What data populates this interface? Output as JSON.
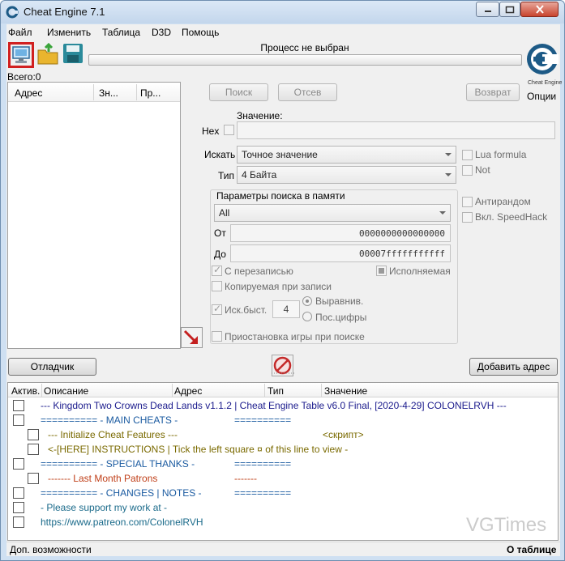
{
  "window": {
    "title": "Cheat Engine 7.1",
    "minimize_icon": "minimize-icon",
    "maximize_icon": "maximize-icon",
    "close_icon": "close-icon"
  },
  "menu": [
    "Файл",
    "Изменить",
    "Таблица",
    "D3D",
    "Помощь"
  ],
  "toolbar": {
    "open_process_icon": "computer-icon",
    "open_file_icon": "folder-icon",
    "save_icon": "floppy-disk-icon"
  },
  "process": {
    "label": "Процесс не выбран"
  },
  "logo": {
    "text": "Cheat Engine",
    "options_label": "Опции"
  },
  "results": {
    "total_label": "Всего:0",
    "columns": [
      "Адрес",
      "Зн...",
      "Пр..."
    ]
  },
  "scan": {
    "first_scan": "Поиск",
    "next_scan": "Отсев",
    "undo_scan": "Возврат",
    "value_label": "Значение:",
    "hex_label": "Hex",
    "scan_type_label": "Искать",
    "scan_type_value": "Точное значение",
    "value_type_label": "Тип",
    "value_type_value": "4 Байта",
    "lua_formula": "Lua formula",
    "not_label": "Not",
    "antirandom": "Антирандом",
    "speedhack": "Вкл. SpeedHack"
  },
  "memory": {
    "group_title": "Параметры поиска в памяти",
    "region_value": "All",
    "from_label": "От",
    "from_value": "0000000000000000",
    "to_label": "До",
    "to_value": "00007fffffffffff",
    "writable": "С перезаписью",
    "executable": "Исполняемая",
    "copy_on_write": "Копируемая при записи",
    "fast_scan": "Иск.быст.",
    "fast_scan_value": "4",
    "alignment": "Выравнив.",
    "last_digits": "Пос.цифры",
    "pause_game": "Приостановка игры при поиске"
  },
  "actions": {
    "debugger": "Отладчик",
    "add_address": "Добавить адрес"
  },
  "cheat_table": {
    "columns": [
      "Актив.",
      "Описание",
      "Адрес",
      "Тип",
      "Значение"
    ],
    "rows": [
      {
        "indent": 0,
        "text": "--- Kingdom Two Crowns Dead Lands v1.1.2 | Cheat Engine Table v6.0 Final, [2020-4-29] COLONELRVH ---",
        "color": "#1a1a8c",
        "extra": ""
      },
      {
        "indent": 0,
        "text": "========== - MAIN CHEATS -",
        "color": "#1a5aa0",
        "extra": "=========="
      },
      {
        "indent": 1,
        "text": "--- Initialize Cheat Features ---",
        "color": "#7a6a00",
        "extra": "<скрипт>"
      },
      {
        "indent": 1,
        "text": "<-[HERE] INSTRUCTIONS | Tick the left square ¤ of this line to view -",
        "color": "#7a6a00",
        "extra": ""
      },
      {
        "indent": 0,
        "text": "========== - SPECIAL THANKS -",
        "color": "#1a5aa0",
        "extra": "=========="
      },
      {
        "indent": 1,
        "text": "-------           Last Month Patrons",
        "color": "#c0401a",
        "extra": "-------"
      },
      {
        "indent": 0,
        "text": "========== - CHANGES | NOTES -",
        "color": "#1a5aa0",
        "extra": "=========="
      },
      {
        "indent": 0,
        "text": "- Please support my work at -",
        "color": "#1a6a8a",
        "extra": ""
      },
      {
        "indent": 0,
        "text": "https://www.patreon.com/ColonelRVH",
        "color": "#1a6a8a",
        "extra": ""
      }
    ]
  },
  "status": {
    "left": "Доп. возможности",
    "right": "О таблице"
  },
  "watermark": "VGTimes"
}
